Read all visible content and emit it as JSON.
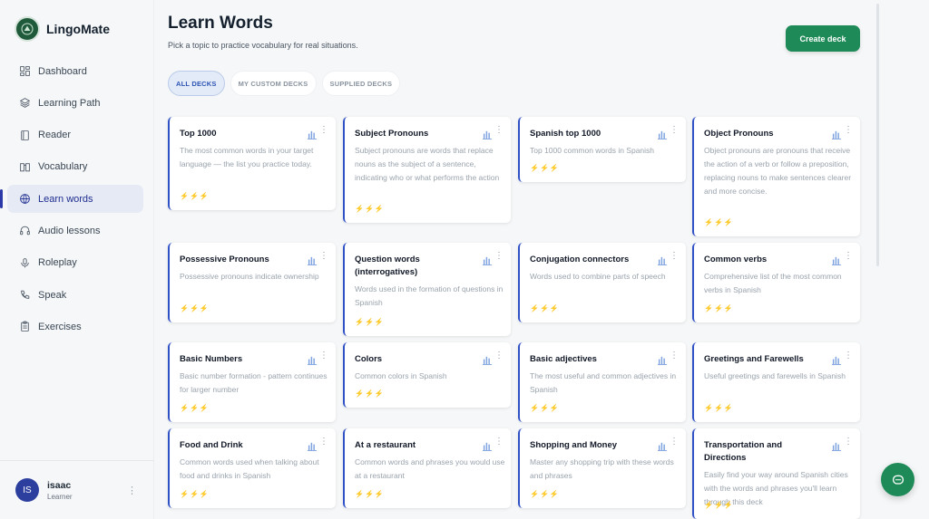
{
  "app": {
    "name": "LingoMate"
  },
  "sidebar": {
    "items": [
      {
        "label": "Dashboard",
        "icon": "grid-icon"
      },
      {
        "label": "Learning Path",
        "icon": "layers-icon"
      },
      {
        "label": "Reader",
        "icon": "book-icon"
      },
      {
        "label": "Vocabulary",
        "icon": "book-open-icon"
      },
      {
        "label": "Learn words",
        "icon": "globe-icon"
      },
      {
        "label": "Audio lessons",
        "icon": "headphones-icon"
      },
      {
        "label": "Roleplay",
        "icon": "mic-icon"
      },
      {
        "label": "Speak",
        "icon": "phone-icon"
      },
      {
        "label": "Exercises",
        "icon": "clipboard-icon"
      }
    ],
    "user": {
      "initials": "IS",
      "name": "isaac",
      "role": "Learner",
      "menu": "⋮"
    }
  },
  "header": {
    "title": "Learn Words",
    "subtitle": "Pick a topic to practice vocabulary for real situations.",
    "create_label": "Create deck"
  },
  "tabs": [
    {
      "label": "ALL DECKS"
    },
    {
      "label": "MY CUSTOM DECKS"
    },
    {
      "label": "SUPPLIED DECKS"
    }
  ],
  "cards": [
    {
      "title": "Top 1000",
      "description": "The most common words in your target language — the list you practice today.",
      "level": 3
    },
    {
      "title": "Subject Pronouns",
      "description": "Subject pronouns are words that replace nouns as the subject of a sentence, indicating who or what performs the action",
      "level": 2
    },
    {
      "title": "Spanish top 1000",
      "description": "Top 1000 common words in Spanish",
      "level": 2
    },
    {
      "title": "Object Pronouns",
      "description": "Object pronouns are pronouns that receive the action of a verb or follow a preposition, replacing nouns to make sentences clearer and more concise.",
      "level": 2
    },
    {
      "title": "Possessive Pronouns",
      "description": "Possessive pronouns indicate ownership",
      "level": 2
    },
    {
      "title": "Question words (interrogatives)",
      "description": "Words used in the formation of questions in Spanish",
      "level": 2
    },
    {
      "title": "Conjugation connectors",
      "description": "Words used to combine parts of speech",
      "level": 2
    },
    {
      "title": "Common verbs",
      "description": "Comprehensive list of the most common verbs in Spanish",
      "level": 2
    },
    {
      "title": "Basic Numbers",
      "description": "Basic number formation - pattern continues for larger number",
      "level": 2
    },
    {
      "title": "Colors",
      "description": "Common colors in Spanish",
      "level": 2
    },
    {
      "title": "Basic adjectives",
      "description": "The most useful and common adjectives in Spanish",
      "level": 2
    },
    {
      "title": "Greetings and Farewells",
      "description": "Useful greetings and farewells in Spanish",
      "level": 2
    },
    {
      "title": "Food and Drink",
      "description": "Common words used when talking about food and drinks in Spanish",
      "level": 2
    },
    {
      "title": "At a restaurant",
      "description": "Common words and phrases you would use at a restaurant",
      "level": 2
    },
    {
      "title": "Shopping and Money",
      "description": "Master any shopping trip with these words and phrases",
      "level": 2
    },
    {
      "title": "Transportation and Directions",
      "description": "Easily find your way around Spanish cities with the words and phrases you'll learn through this deck",
      "level": 2
    }
  ],
  "colors": {
    "accent": "#1d8a57",
    "active": "#2b3aa8",
    "card_border": "#3151c7"
  }
}
